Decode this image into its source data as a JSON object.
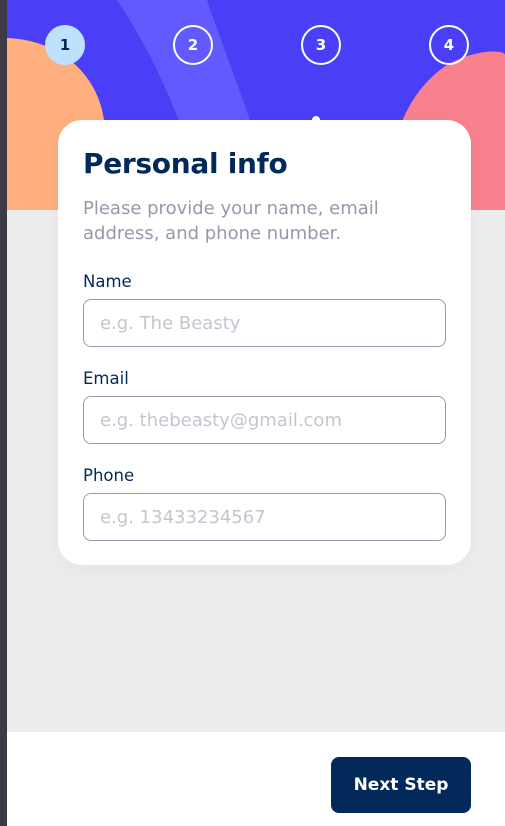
{
  "colors": {
    "header_bg": "#4a3ff6",
    "header_band_light": "#6259ff",
    "blob_orange": "#ffaf7e",
    "blob_pink": "#f9818e",
    "marine_blue": "#02295a",
    "active_step_bg": "#bee2fd",
    "cool_gray": "#9699ab",
    "placeholder": "#c4c5cf"
  },
  "steps": [
    {
      "number": "1",
      "active": true
    },
    {
      "number": "2",
      "active": false
    },
    {
      "number": "3",
      "active": false
    },
    {
      "number": "4",
      "active": false
    }
  ],
  "form": {
    "title": "Personal info",
    "subtitle": "Please provide your name, email address, and phone number.",
    "fields": [
      {
        "label": "Name",
        "placeholder": "e.g. The Beasty",
        "value": ""
      },
      {
        "label": "Email",
        "placeholder": "e.g. thebeasty@gmail.com",
        "value": ""
      },
      {
        "label": "Phone",
        "placeholder": "e.g. 13433234567",
        "value": ""
      }
    ]
  },
  "footer": {
    "next_label": "Next Step"
  }
}
